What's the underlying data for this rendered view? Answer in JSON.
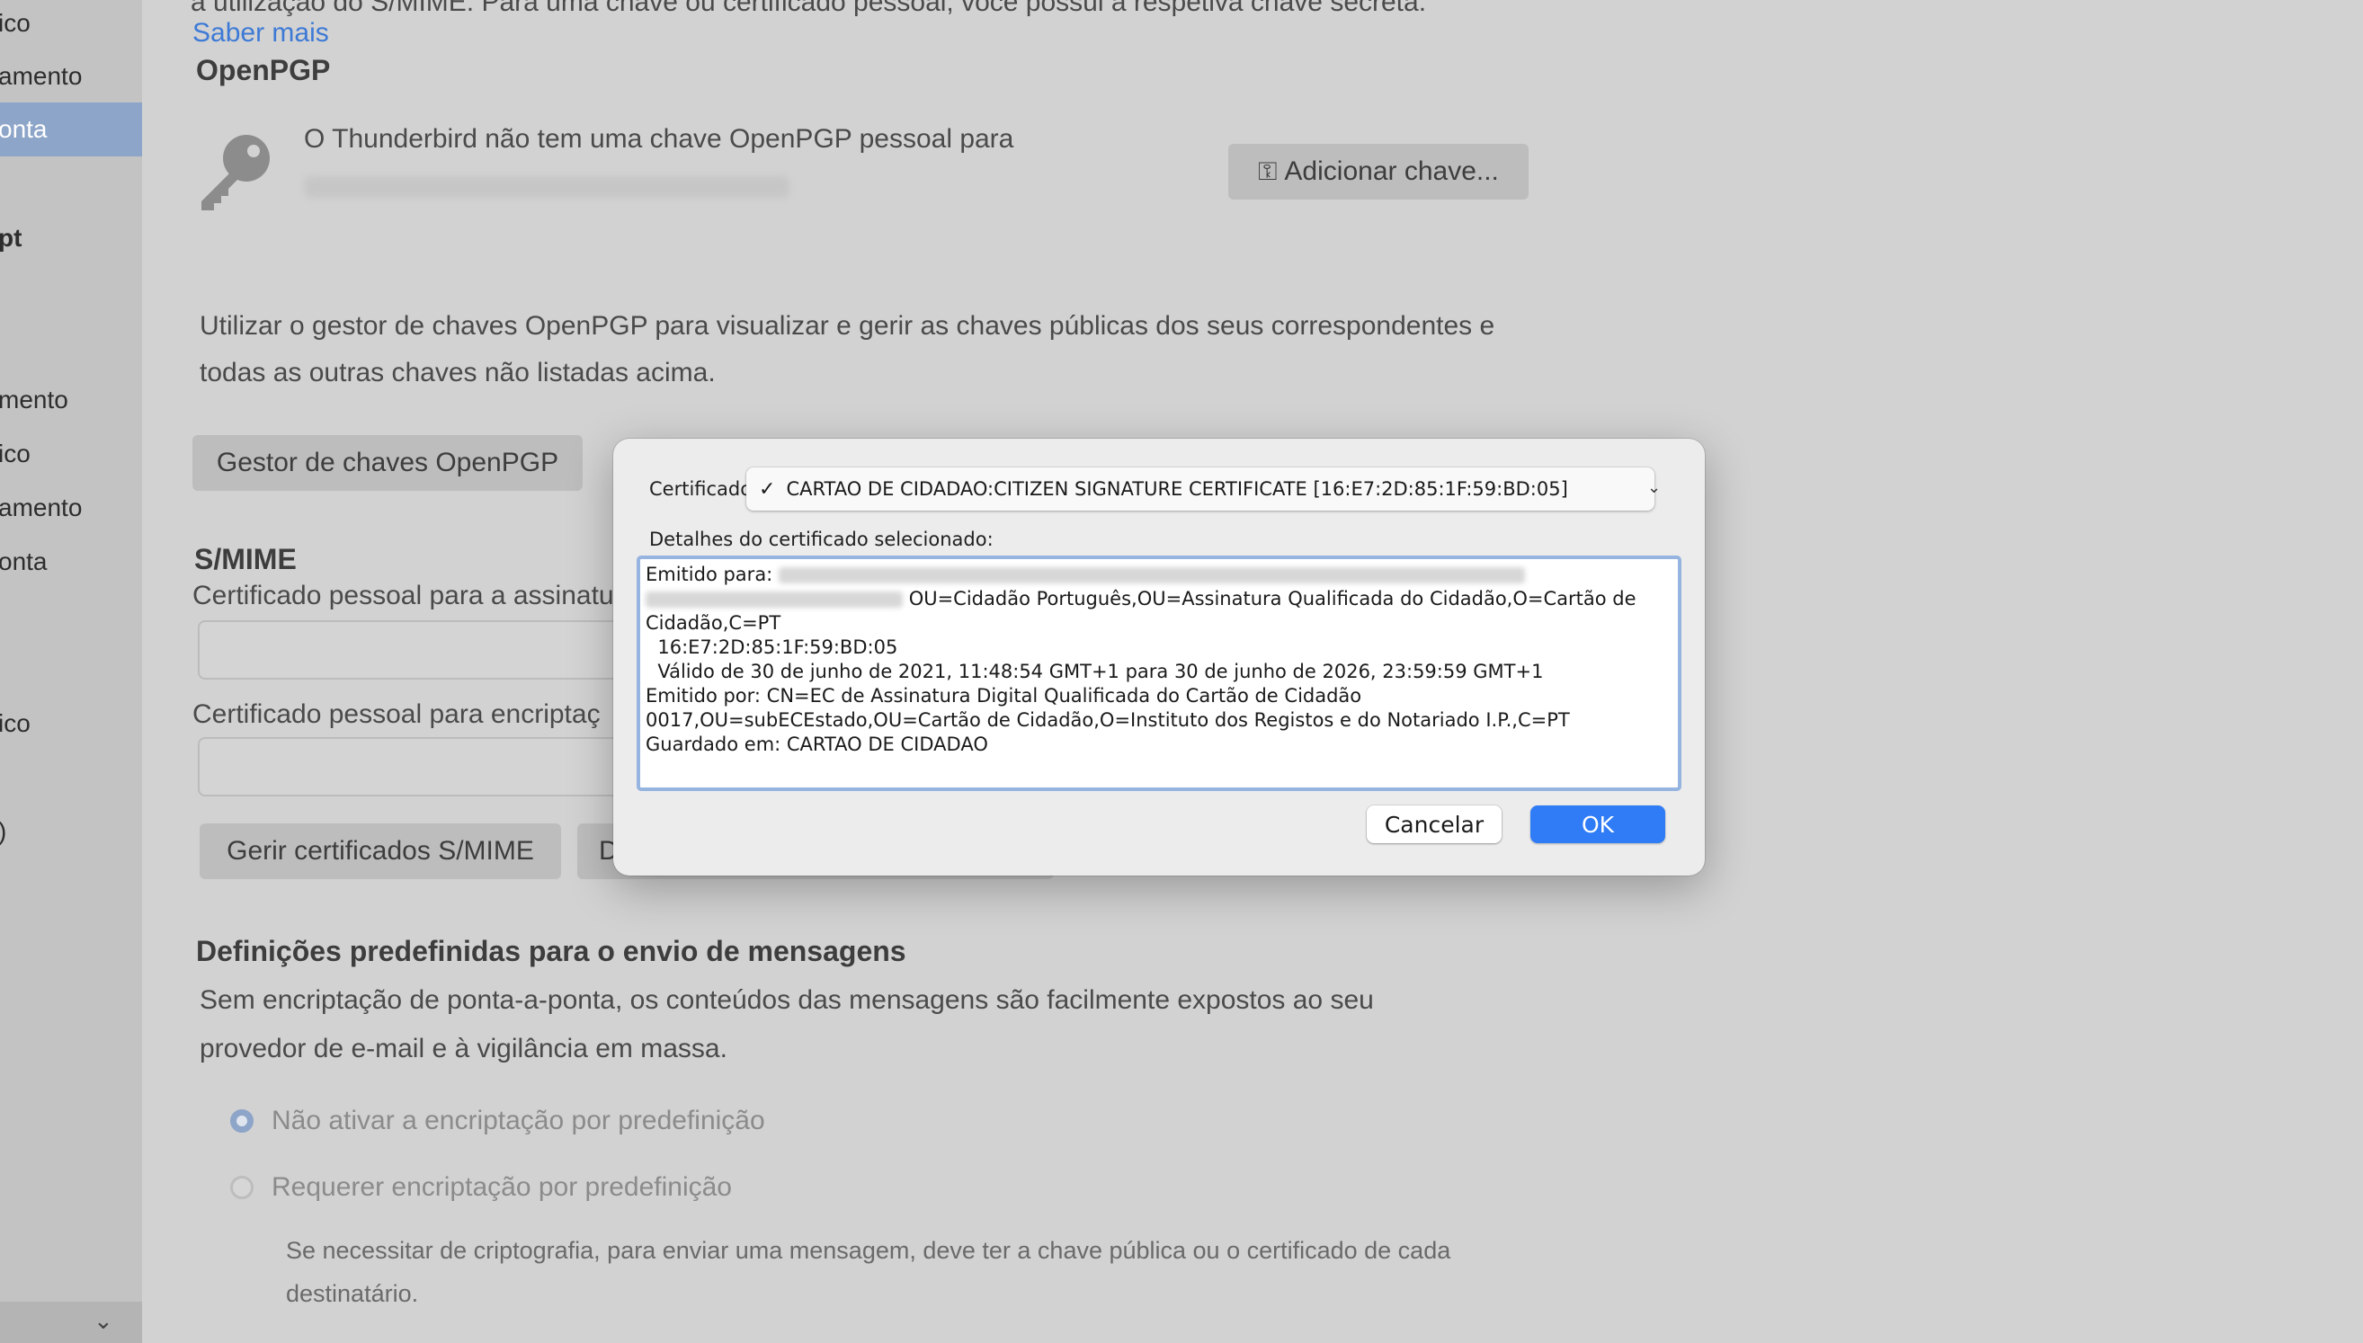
{
  "sidebar": {
    "items": [
      {
        "label": "ico",
        "top": 0
      },
      {
        "label": "amento"
      },
      {
        "label": "onta"
      },
      {
        "label": "pt"
      },
      {
        "label": "mento"
      },
      {
        "label": "ico"
      },
      {
        "label": "amento"
      },
      {
        "label": "onta"
      },
      {
        "label": "ico"
      },
      {
        "label": ")"
      }
    ]
  },
  "page": {
    "top_text": "a utilização do S/MIME. Para uma chave ou certificado pessoal, você possui a respetiva chave secreta.",
    "learn_more": "Saber mais",
    "openpgp_heading": "OpenPGP",
    "no_key_text": "O Thunderbird não tem uma chave OpenPGP pessoal para",
    "add_key_button": "Adicionar chave...",
    "manager_text_1": "Utilizar o gestor de chaves OpenPGP para visualizar e gerir as chaves públicas dos seus correspondentes e",
    "manager_text_2": "todas as outras chaves não listadas acima.",
    "key_manager_button": "Gestor de chaves OpenPGP",
    "smime_heading": "S/MIME",
    "signing_cert_label": "Certificado pessoal para a assinatu",
    "encryption_cert_label": "Certificado pessoal para encriptaç",
    "manage_smime_button": "Gerir certificados S/MIME",
    "second_button_partial": "D",
    "defaults_heading": "Definições predefinidas para o envio de mensagens",
    "defaults_text_1": "Sem encriptação de ponta-a-ponta, os conteúdos das mensagens são facilmente expostos ao seu",
    "defaults_text_2": "provedor de e-mail e à vigilância em massa.",
    "radio_no_encrypt": "Não ativar a encriptação por predefinição",
    "radio_require_encrypt": "Requerer encriptação por predefinição",
    "require_note_1": "Se necessitar de criptografia, para enviar uma mensagem, deve ter a chave pública ou o certificado de cada",
    "require_note_2": "destinatário."
  },
  "dialog": {
    "certificate_label": "Certificado",
    "selected_certificate": "CARTAO DE CIDADAO:CITIZEN SIGNATURE CERTIFICATE [16:E7:2D:85:1F:59:BD:05]",
    "details_label": "Detalhes do certificado selecionado:",
    "details": {
      "issued_to_label": "Emitido para:",
      "issued_to_suffix": "OU=Cidadão Português,OU=Assinatura Qualificada do Cidadão,O=Cartão de",
      "issued_to_cont": "Cidadão,C=PT",
      "serial": "  16:E7:2D:85:1F:59:BD:05",
      "validity": "  Válido de 30 de junho de 2021, 11:48:54 GMT+1 para 30 de junho de 2026, 23:59:59 GMT+1",
      "issued_by_1": "Emitido por: CN=EC de Assinatura Digital Qualificada do Cartão de Cidadão",
      "issued_by_2": "0017,OU=subECEstado,OU=Cartão de Cidadão,O=Instituto dos Registos e do Notariado I.P.,C=PT",
      "stored_in": "Guardado em: CARTAO DE CIDADAO"
    },
    "cancel_button": "Cancelar",
    "ok_button": "OK"
  },
  "colors": {
    "accent": "#2f7cf6",
    "selected_sidebar": "#8da5c8",
    "link": "#3d7ad6"
  }
}
